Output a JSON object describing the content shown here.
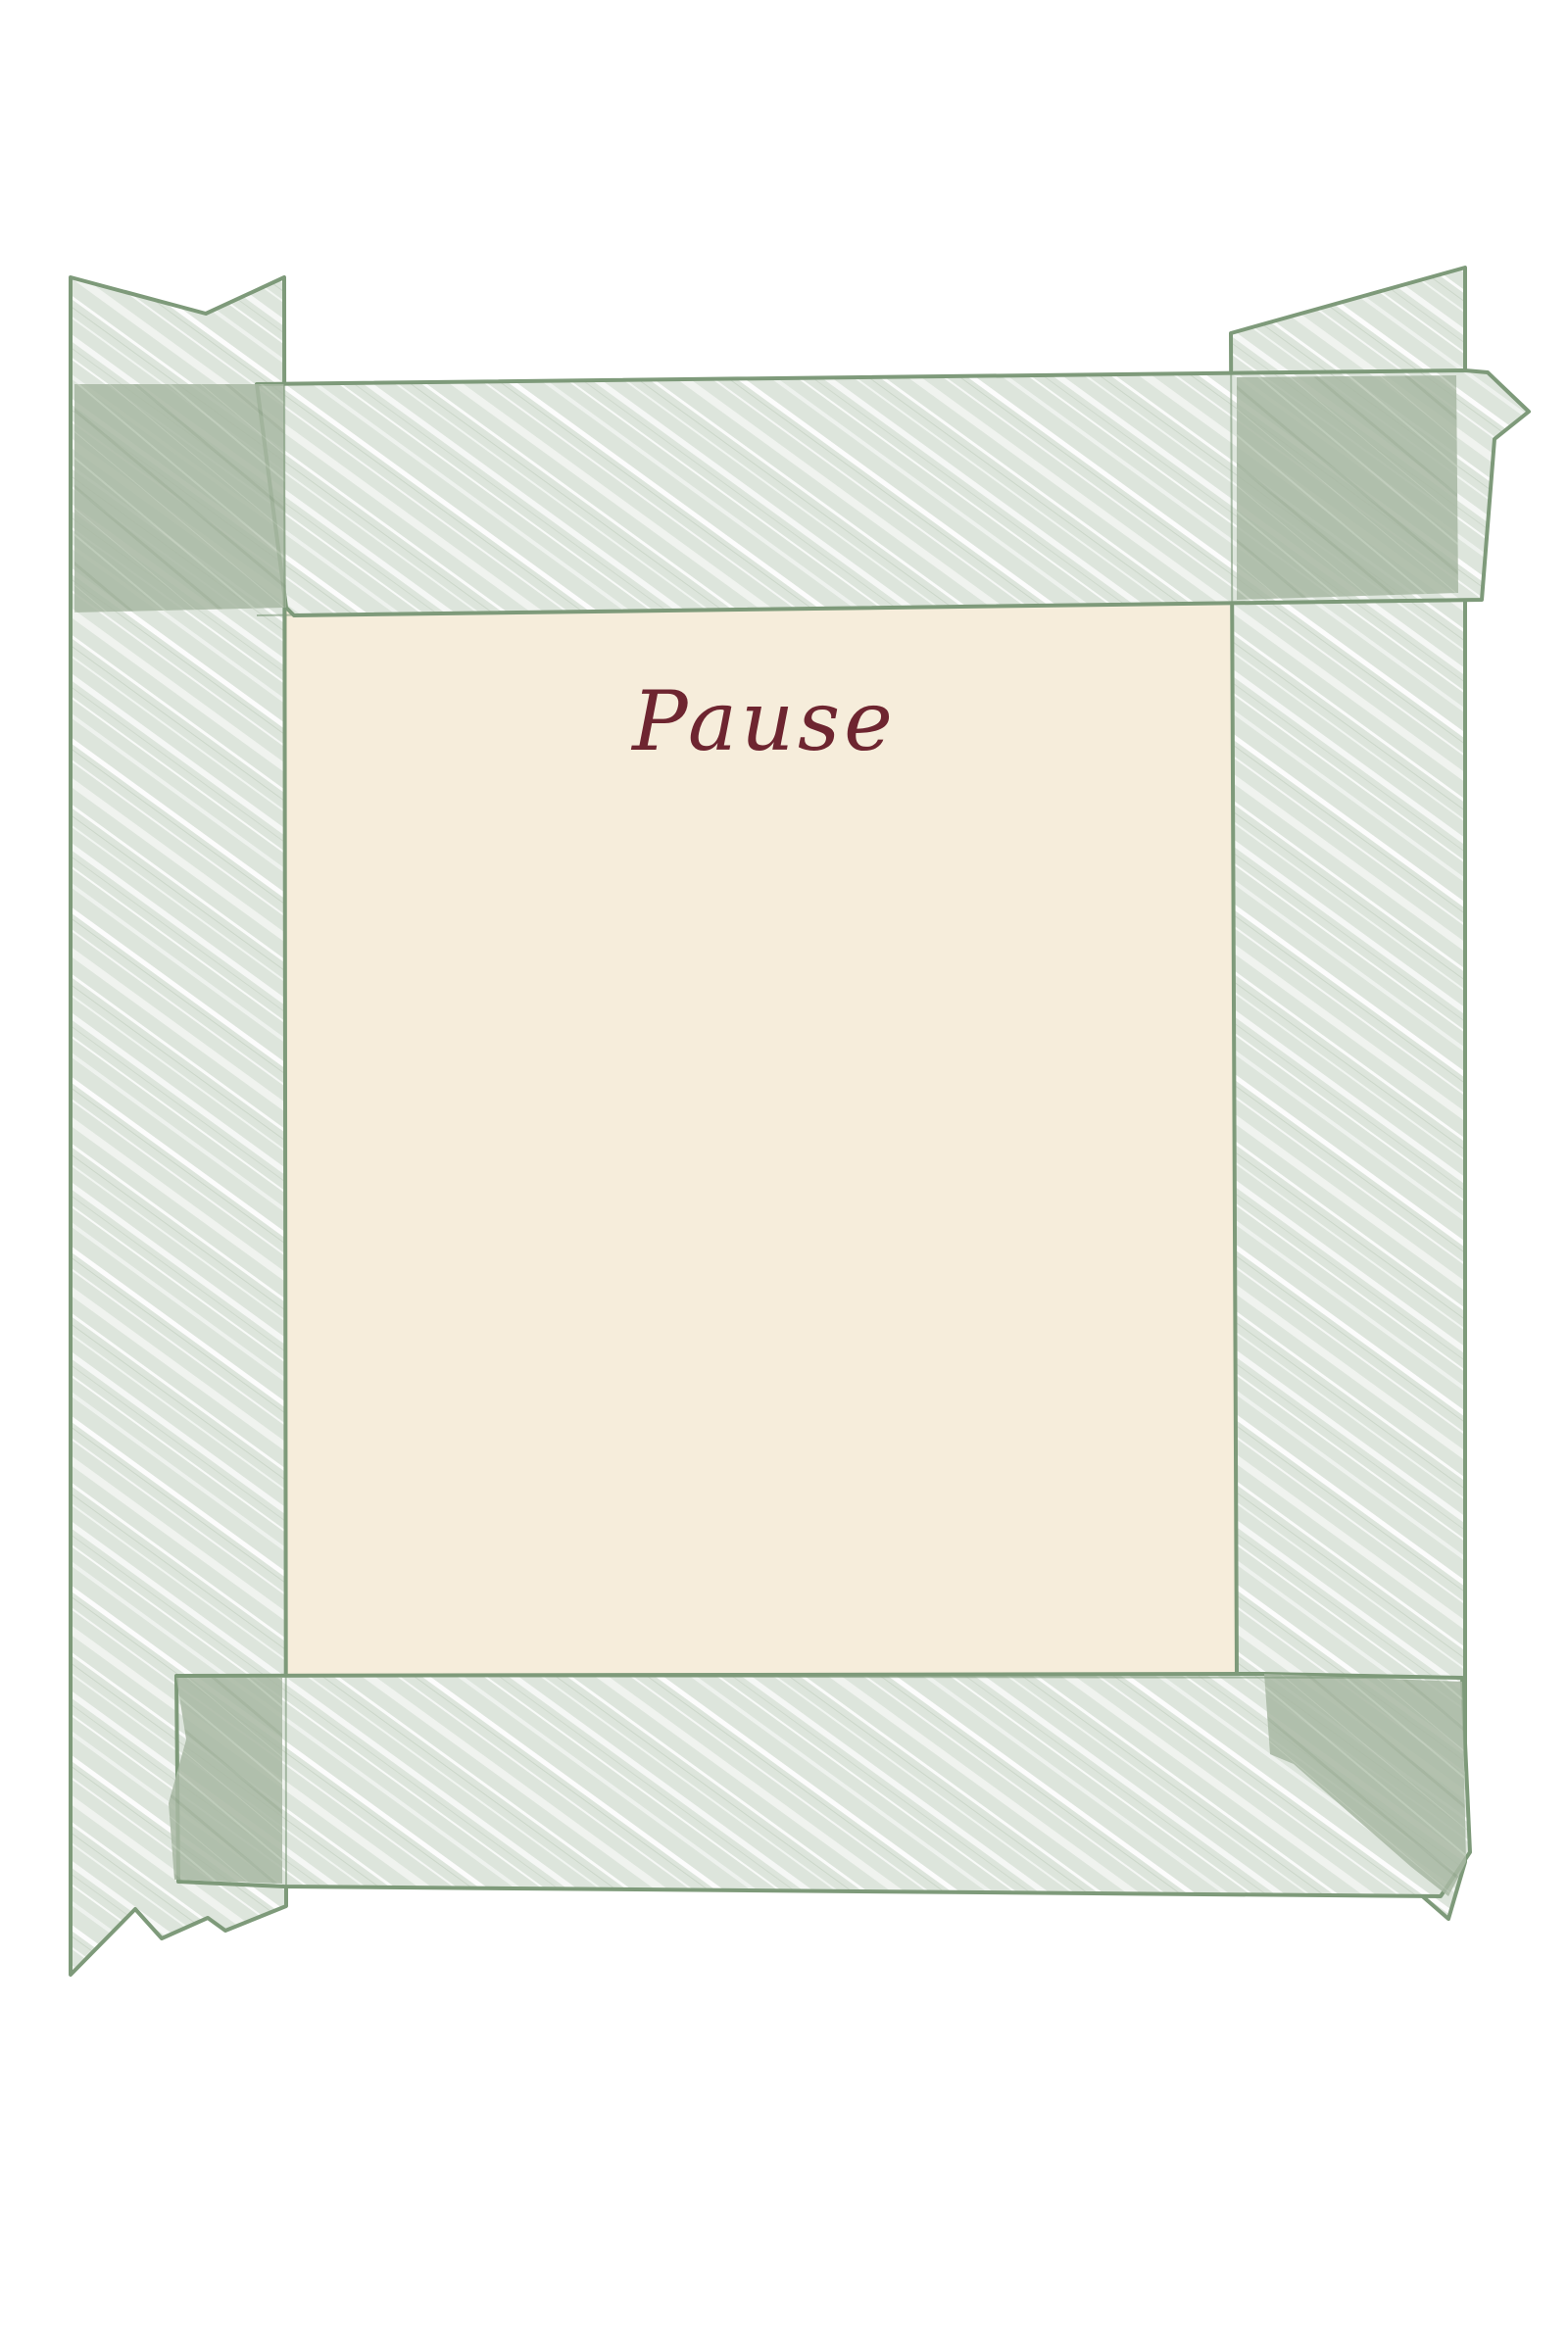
{
  "note": {
    "title": "Pause"
  },
  "colors": {
    "page_background": "#ffffff",
    "note_paper": "#f6eddb",
    "tape_fill": "#dde5dc",
    "tape_streak": "#ffffff",
    "tape_outline": "#7e9a7a",
    "tape_overlap": "#a8b8a3",
    "title_ink": "#6e2530"
  },
  "icons": {
    "tape_strips": "masking-tape-strip",
    "overlap_patches": "tape-overlap-patch"
  }
}
